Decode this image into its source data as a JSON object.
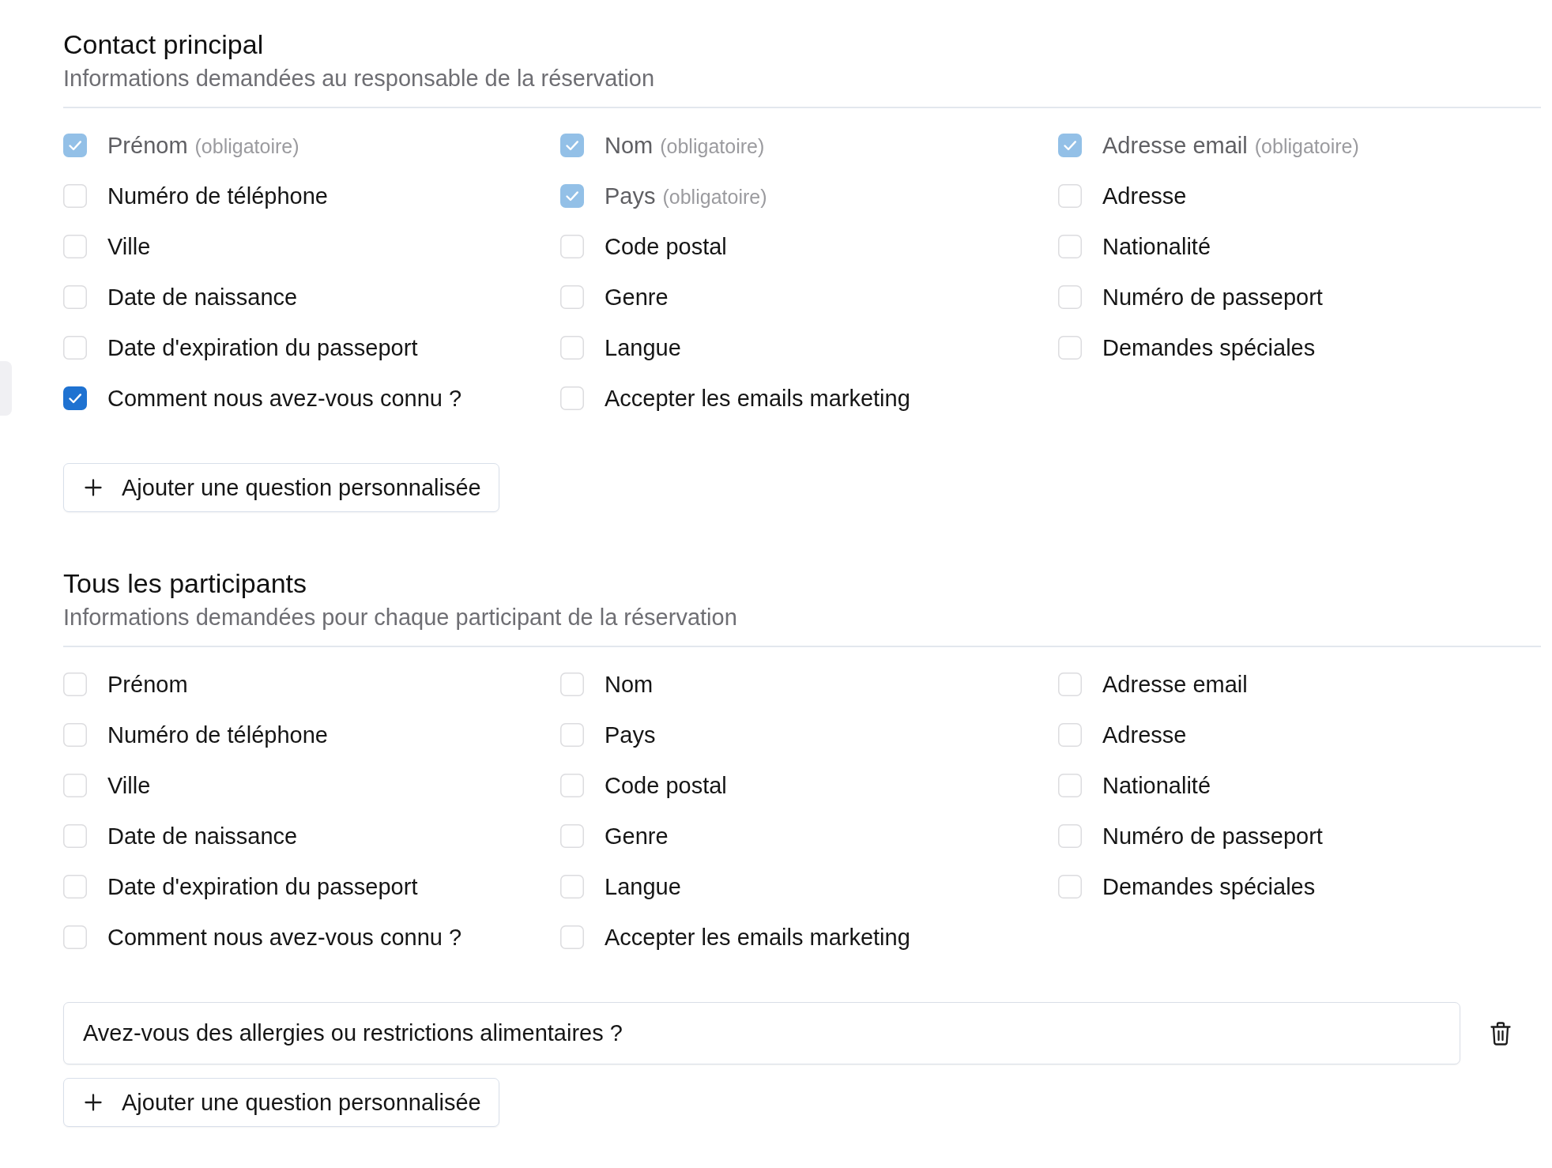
{
  "sections": [
    {
      "title": "Contact principal",
      "subtitle": "Informations demandées au responsable de la réservation",
      "fields": [
        {
          "label": "Prénom",
          "note": "(obligatoire)",
          "checked": true,
          "disabled": true
        },
        {
          "label": "Nom",
          "note": "(obligatoire)",
          "checked": true,
          "disabled": true
        },
        {
          "label": "Adresse email",
          "note": "(obligatoire)",
          "checked": true,
          "disabled": true
        },
        {
          "label": "Numéro de téléphone",
          "checked": false,
          "disabled": false
        },
        {
          "label": "Pays",
          "note": "(obligatoire)",
          "checked": true,
          "disabled": true
        },
        {
          "label": "Adresse",
          "checked": false,
          "disabled": false
        },
        {
          "label": "Ville",
          "checked": false,
          "disabled": false
        },
        {
          "label": "Code postal",
          "checked": false,
          "disabled": false
        },
        {
          "label": "Nationalité",
          "checked": false,
          "disabled": false
        },
        {
          "label": "Date de naissance",
          "checked": false,
          "disabled": false
        },
        {
          "label": "Genre",
          "checked": false,
          "disabled": false
        },
        {
          "label": "Numéro de passeport",
          "checked": false,
          "disabled": false
        },
        {
          "label": "Date d'expiration du passeport",
          "checked": false,
          "disabled": false
        },
        {
          "label": "Langue",
          "checked": false,
          "disabled": false
        },
        {
          "label": "Demandes spéciales",
          "checked": false,
          "disabled": false
        },
        {
          "label": "Comment nous avez-vous connu ?",
          "checked": true,
          "disabled": false
        },
        {
          "label": "Accepter les emails marketing",
          "checked": false,
          "disabled": false
        }
      ],
      "add_button": {
        "label": "Ajouter une question personnalisée"
      }
    },
    {
      "title": "Tous les participants",
      "subtitle": "Informations demandées pour chaque participant de la réservation",
      "fields": [
        {
          "label": "Prénom",
          "checked": false,
          "disabled": false
        },
        {
          "label": "Nom",
          "checked": false,
          "disabled": false
        },
        {
          "label": "Adresse email",
          "checked": false,
          "disabled": false
        },
        {
          "label": "Numéro de téléphone",
          "checked": false,
          "disabled": false
        },
        {
          "label": "Pays",
          "checked": false,
          "disabled": false
        },
        {
          "label": "Adresse",
          "checked": false,
          "disabled": false
        },
        {
          "label": "Ville",
          "checked": false,
          "disabled": false
        },
        {
          "label": "Code postal",
          "checked": false,
          "disabled": false
        },
        {
          "label": "Nationalité",
          "checked": false,
          "disabled": false
        },
        {
          "label": "Date de naissance",
          "checked": false,
          "disabled": false
        },
        {
          "label": "Genre",
          "checked": false,
          "disabled": false
        },
        {
          "label": "Numéro de passeport",
          "checked": false,
          "disabled": false
        },
        {
          "label": "Date d'expiration du passeport",
          "checked": false,
          "disabled": false
        },
        {
          "label": "Langue",
          "checked": false,
          "disabled": false
        },
        {
          "label": "Demandes spéciales",
          "checked": false,
          "disabled": false
        },
        {
          "label": "Comment nous avez-vous connu ?",
          "checked": false,
          "disabled": false
        },
        {
          "label": "Accepter les emails marketing",
          "checked": false,
          "disabled": false
        }
      ],
      "custom_questions": [
        {
          "value": "Avez-vous des allergies ou restrictions alimentaires ?"
        }
      ],
      "add_button": {
        "label": "Ajouter une question personnalisée"
      }
    }
  ]
}
